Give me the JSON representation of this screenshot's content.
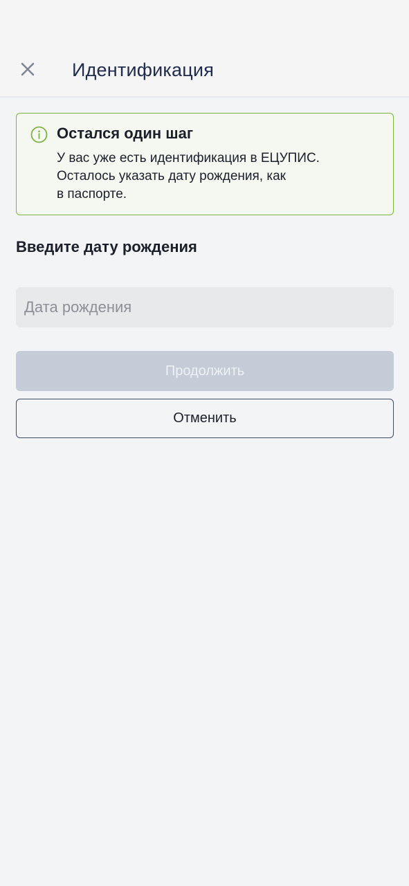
{
  "header": {
    "title": "Идентификация",
    "close_icon": "close-icon"
  },
  "alert": {
    "icon": "info-circle-icon",
    "title": "Остался один шаг",
    "text_line1": "У вас уже есть идентификация в ЕЦУПИС.",
    "text_line2": "Осталось указать дату рождения, как",
    "text_line3": "в паспорте.",
    "accent_color": "#7cb342"
  },
  "form": {
    "section_title": "Введите дату рождения",
    "birthdate_placeholder": "Дата рождения",
    "birthdate_value": ""
  },
  "actions": {
    "continue_label": "Продолжить",
    "continue_disabled": true,
    "cancel_label": "Отменить"
  }
}
